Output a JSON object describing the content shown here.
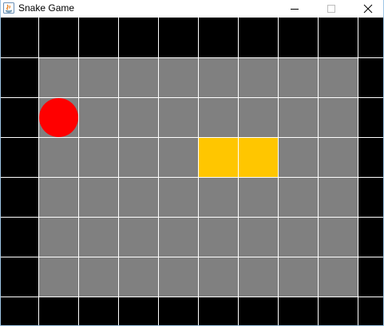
{
  "window": {
    "title": "Snake Game"
  },
  "titlebar_controls": [
    {
      "name": "minimize",
      "icon": "minimize-icon"
    },
    {
      "name": "maximize",
      "icon": "maximize-icon"
    },
    {
      "name": "close",
      "icon": "close-icon"
    }
  ],
  "game": {
    "columns": 10,
    "rows": 8,
    "colors": {
      "wall": "#000000",
      "floor": "#808080",
      "grid": "#ffffff",
      "food": "#ff0000",
      "snake": "#ffc600"
    },
    "food": {
      "col": 1,
      "row": 2
    },
    "snake": [
      {
        "col": 5,
        "row": 3
      },
      {
        "col": 6,
        "row": 3
      }
    ]
  }
}
